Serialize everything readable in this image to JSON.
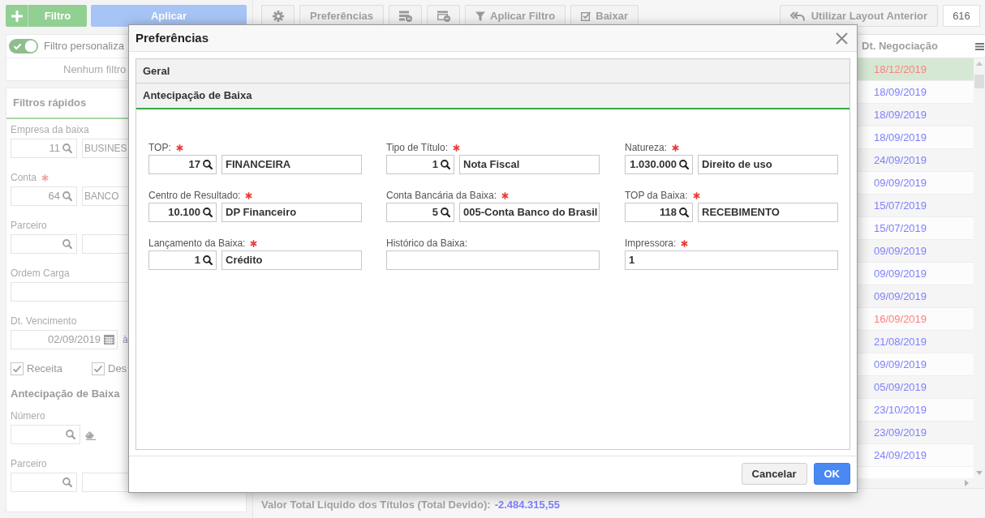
{
  "left_panel": {
    "add_filter_button": {
      "label": "Filtro"
    },
    "apply_button": {
      "label": "Aplicar"
    },
    "custom_filter": {
      "label": "Filtro personaliza",
      "on": true,
      "empty_text": "Nenhum filtro"
    },
    "quick_filters": {
      "title": "Filtros rápidos",
      "items": [
        {
          "kind": "lookup",
          "label": "Empresa da baixa",
          "required": false,
          "code": "11",
          "name": "BUSINES"
        },
        {
          "kind": "lookup",
          "label": "Conta",
          "required": true,
          "code": "64",
          "name": "BANCO"
        },
        {
          "kind": "lookup",
          "label": "Parceiro",
          "required": false
        },
        {
          "kind": "text",
          "label": "Ordem Carga",
          "required": false
        },
        {
          "kind": "date_range",
          "label": "Dt. Vencimento",
          "required": false,
          "value": "02/09/2019",
          "separator": "à"
        },
        {
          "kind": "checkboxes",
          "options": [
            {
              "label": "Receita",
              "checked": true
            },
            {
              "label": "Des",
              "checked": true
            }
          ]
        },
        {
          "kind": "heading",
          "label": "Antecipação de Baixa"
        },
        {
          "kind": "search",
          "label": "Número",
          "required": false
        },
        {
          "kind": "lookup",
          "label": "Parceiro",
          "required": false
        }
      ]
    }
  },
  "toolbar": {
    "buttons": [
      {
        "kind": "icon"
      },
      {
        "kind": "text",
        "label": "Preferências"
      },
      {
        "kind": "icon"
      },
      {
        "kind": "icon"
      },
      {
        "kind": "icon_text",
        "label": "Aplicar Filtro"
      },
      {
        "kind": "icon_text",
        "label": "Baixar"
      }
    ],
    "layout_button": {
      "label": "Utilizar Layout Anterior"
    },
    "record_count": "616"
  },
  "table": {
    "columns": [
      {
        "label": "Dt. Negociação"
      }
    ],
    "rows": [
      {
        "date": "18/12/2019",
        "color": "#ff7f7f",
        "selected": true
      },
      {
        "date": "18/09/2019",
        "color": "#7f7fff",
        "selected": false
      },
      {
        "date": "18/09/2019",
        "color": "#7f7fff",
        "selected": false
      },
      {
        "date": "18/09/2019",
        "color": "#7f7fff",
        "selected": false
      },
      {
        "date": "24/09/2019",
        "color": "#7f7fff",
        "selected": false
      },
      {
        "date": "09/09/2019",
        "color": "#7f7fff",
        "selected": false
      },
      {
        "date": "15/07/2019",
        "color": "#7f7fff",
        "selected": false
      },
      {
        "date": "15/07/2019",
        "color": "#7f7fff",
        "selected": false
      },
      {
        "date": "09/09/2019",
        "color": "#7f7fff",
        "selected": false
      },
      {
        "date": "09/09/2019",
        "color": "#7f7fff",
        "selected": false
      },
      {
        "date": "09/09/2019",
        "color": "#7f7fff",
        "selected": false
      },
      {
        "date": "16/09/2019",
        "color": "#ff7f7f",
        "selected": false
      },
      {
        "date": "21/08/2019",
        "color": "#7f7fff",
        "selected": false
      },
      {
        "date": "09/09/2019",
        "color": "#7f7fff",
        "selected": false
      },
      {
        "date": "05/09/2019",
        "color": "#7f7fff",
        "selected": false
      },
      {
        "date": "23/10/2019",
        "color": "#7f7fff",
        "selected": false
      },
      {
        "date": "23/09/2019",
        "color": "#7f7fff",
        "selected": false
      },
      {
        "date": "24/09/2019",
        "color": "#7f7fff",
        "selected": false
      }
    ]
  },
  "summary": {
    "label": "Valor Total Líquido dos Títulos (Total Devido):",
    "value": "-2.484.315,55"
  },
  "dialog": {
    "title": "Preferências",
    "sections": [
      {
        "title": "Geral",
        "expanded": false
      },
      {
        "title": "Antecipação de Baixa",
        "expanded": true,
        "fields": [
          {
            "kind": "lookup",
            "label": "TOP:",
            "required": true,
            "code": "17",
            "name": "FINANCEIRA"
          },
          {
            "kind": "lookup",
            "label": "Tipo de Título:",
            "required": true,
            "code": "1",
            "name": "Nota Fiscal"
          },
          {
            "kind": "lookup",
            "label": "Natureza:",
            "required": true,
            "code": "1.030.000",
            "name": "Direito de uso"
          },
          {
            "kind": "lookup",
            "label": "Centro de Resultado:",
            "required": true,
            "code": "10.100",
            "name": "DP Financeiro"
          },
          {
            "kind": "lookup",
            "label": "Conta Bancária da Baixa:",
            "required": true,
            "code": "5",
            "name": "005-Conta Banco do Brasil"
          },
          {
            "kind": "lookup",
            "label": "TOP da Baixa:",
            "required": true,
            "code": "118",
            "name": "RECEBIMENTO"
          },
          {
            "kind": "lookup",
            "label": "Lançamento da Baixa:",
            "required": true,
            "code": "1",
            "name": "Crédito"
          },
          {
            "kind": "text",
            "label": "Histórico da Baixa:",
            "required": false
          },
          {
            "kind": "text",
            "label": "Impressora:",
            "required": true,
            "value": "1"
          }
        ]
      }
    ],
    "buttons": [
      {
        "kind": "secondary",
        "label": "Cancelar"
      },
      {
        "kind": "primary",
        "label": "OK"
      }
    ]
  }
}
